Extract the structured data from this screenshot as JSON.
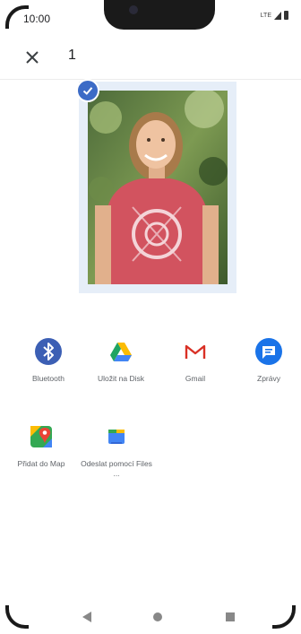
{
  "status_bar": {
    "time": "10:00",
    "network": "LTE"
  },
  "app_bar": {
    "selected_count": "1"
  },
  "photo": {
    "selected": true,
    "description_icon": "check-icon"
  },
  "share_targets": [
    {
      "label": "Bluetooth",
      "icon": "bluetooth-icon",
      "color": "#3c5fb4"
    },
    {
      "label": "Uložit na Disk",
      "icon": "google-drive-icon",
      "color": "#1fa463"
    },
    {
      "label": "Gmail",
      "icon": "gmail-icon",
      "color": "#d93025"
    },
    {
      "label": "Zprávy",
      "icon": "messages-icon",
      "color": "#1a73e8"
    },
    {
      "label": "Přidat do Map",
      "icon": "google-maps-icon",
      "color": "#34a853"
    },
    {
      "label": "Odeslat pomocí Files ...",
      "icon": "files-icon",
      "color": "#4285f4"
    }
  ],
  "nav_bar": {
    "buttons": [
      "back",
      "home",
      "recents"
    ]
  },
  "colors": {
    "accent": "#3c6bc6",
    "photo_frame": "#e6eef8"
  }
}
